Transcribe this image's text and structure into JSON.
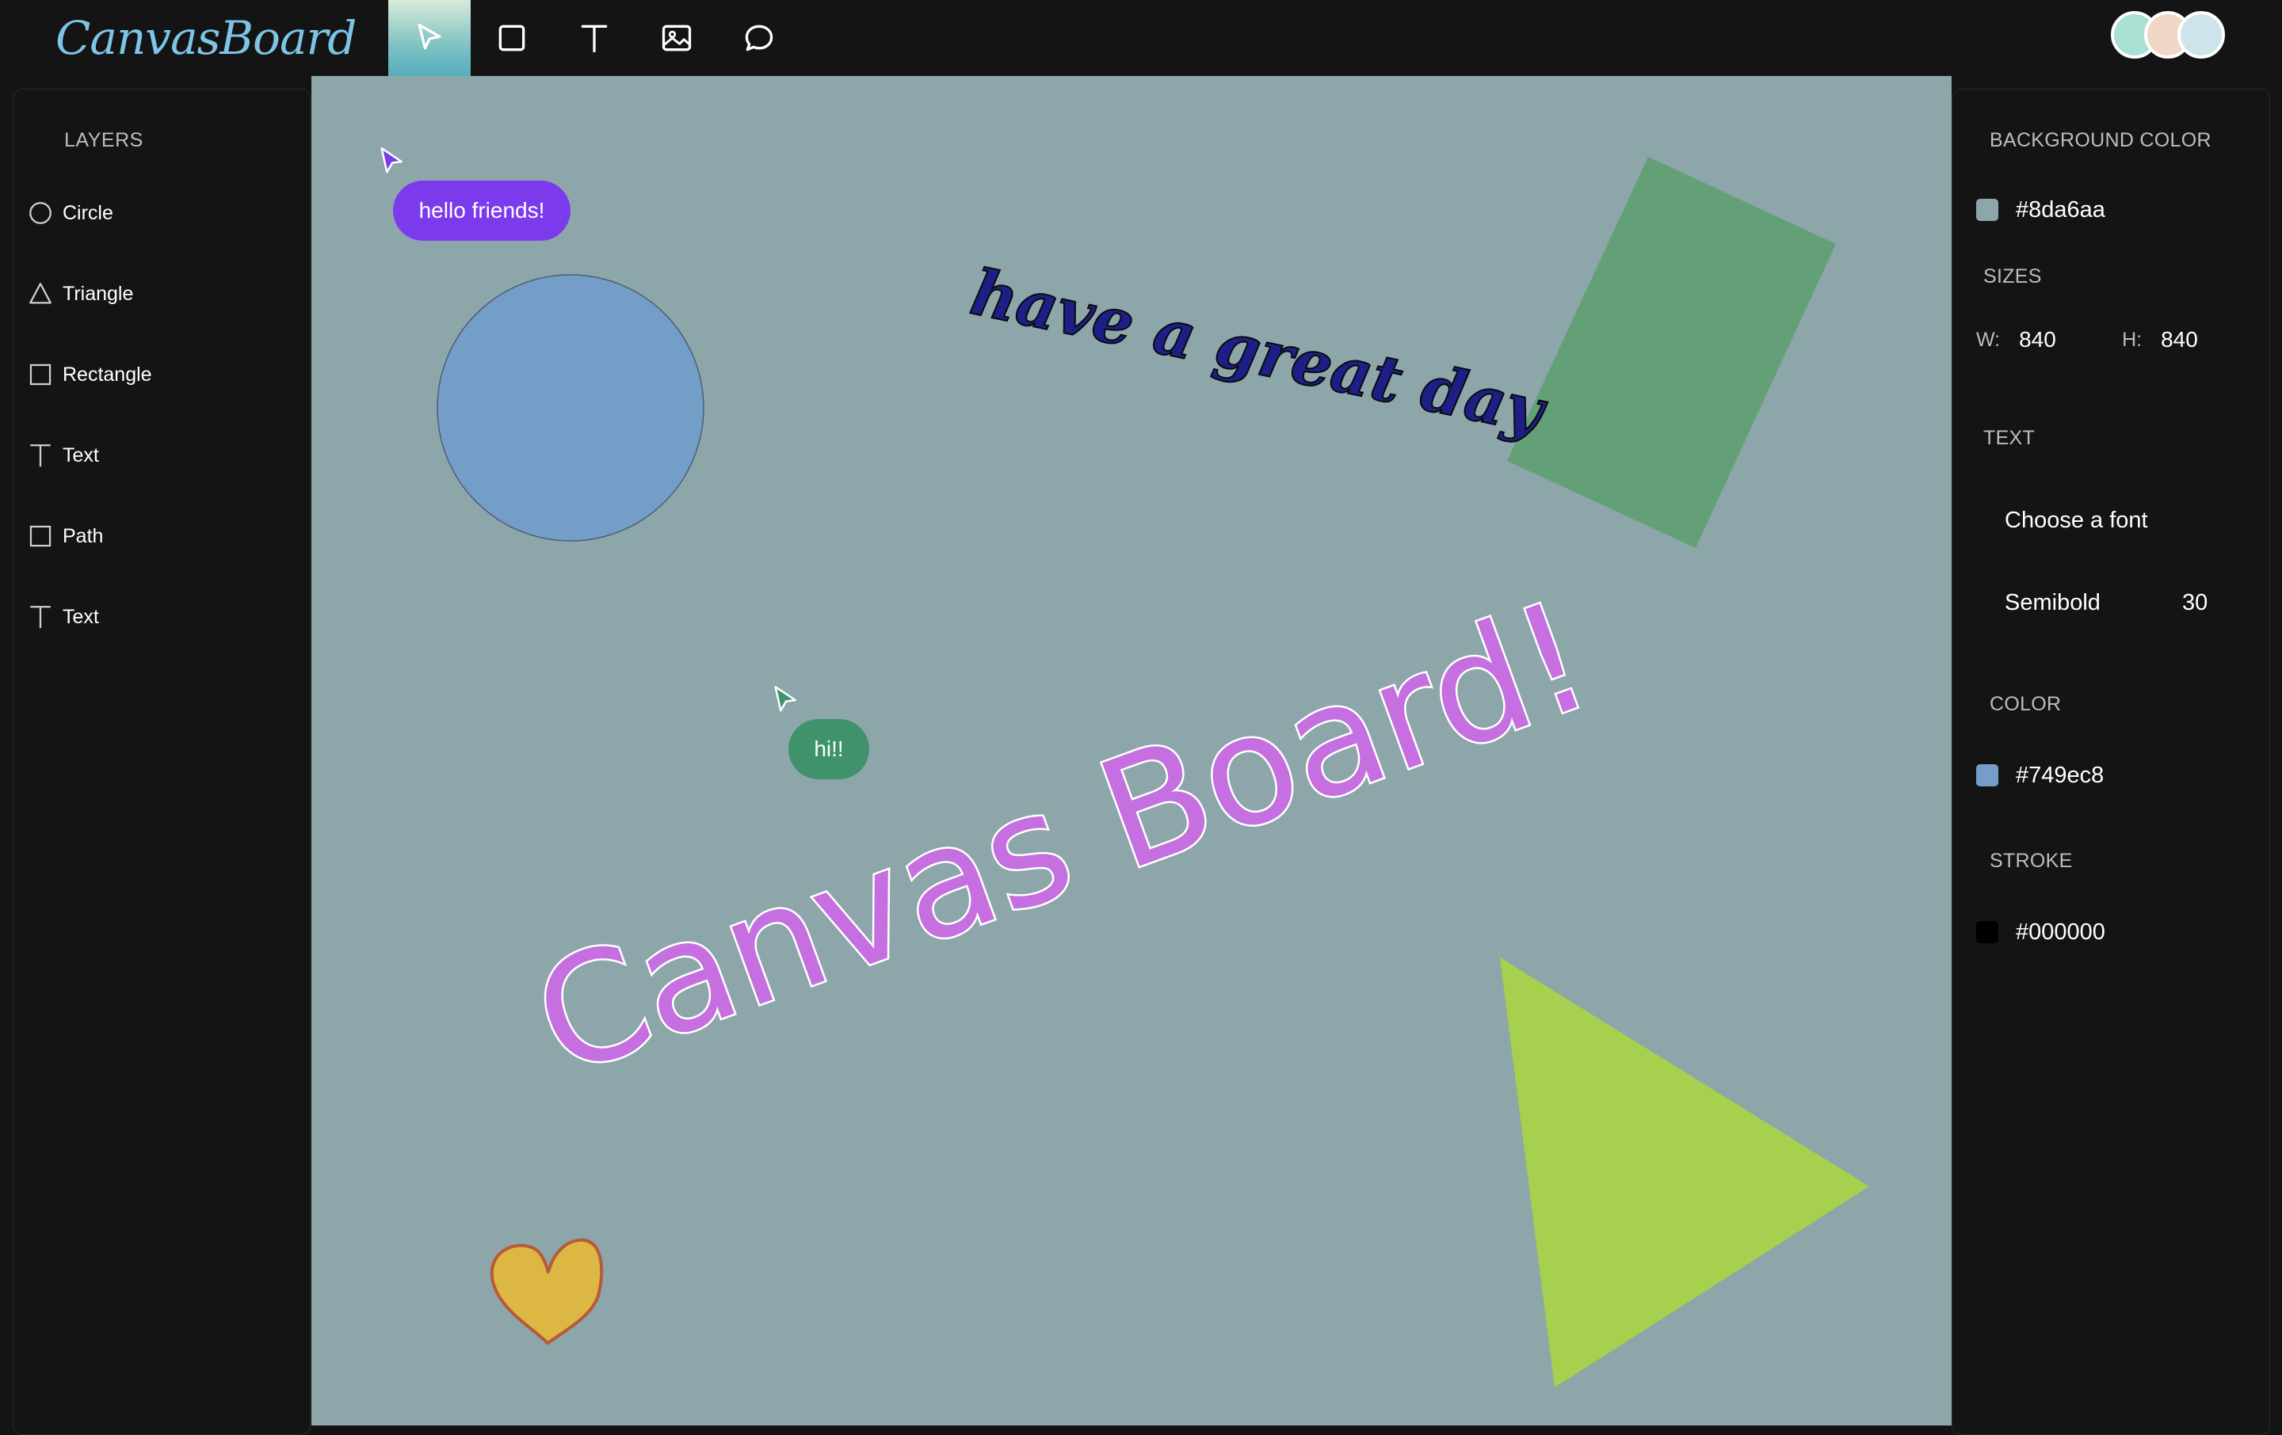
{
  "app": {
    "logo_text": "CanvasBoard"
  },
  "toolbar": {
    "tools": [
      {
        "name": "select",
        "icon": "cursor-arrow-icon",
        "active": true
      },
      {
        "name": "rectangle",
        "icon": "square-icon"
      },
      {
        "name": "text",
        "icon": "text-t-icon"
      },
      {
        "name": "image",
        "icon": "image-icon"
      },
      {
        "name": "comment",
        "icon": "speech-bubble-icon"
      }
    ]
  },
  "collaborators": [
    {
      "color": "#a8e0d4"
    },
    {
      "color": "#f0d7c6"
    },
    {
      "color": "#cfe3ec"
    }
  ],
  "layers": {
    "title": "LAYERS",
    "items": [
      {
        "label": "Circle",
        "icon": "circle-icon"
      },
      {
        "label": "Triangle",
        "icon": "triangle-icon"
      },
      {
        "label": "Rectangle",
        "icon": "square-icon"
      },
      {
        "label": "Text",
        "icon": "text-t-icon"
      },
      {
        "label": "Path",
        "icon": "square-icon"
      },
      {
        "label": "Text",
        "icon": "text-t-icon"
      }
    ]
  },
  "canvas": {
    "background": "#8da6aa",
    "comments": [
      {
        "text": "hello friends!",
        "color": "#7c3aed"
      },
      {
        "text": "hi!!",
        "color": "#3f926b"
      }
    ],
    "title_text": "Canvas Board!",
    "title_color": "#c66fe0",
    "script_text": "have a great day",
    "script_color": "#1d1f86",
    "circle_fill": "#749ec8",
    "rectangle_fill": "#64a077",
    "triangle_fill": "#a6d04d",
    "heart_fill": "#dcb744",
    "heart_stroke": "#b85a3a"
  },
  "properties": {
    "background": {
      "title": "BACKGROUND COLOR",
      "value": "#8da6aa"
    },
    "sizes": {
      "title": "SIZES",
      "w_label": "W:",
      "w_value": "840",
      "h_label": "H:",
      "h_value": "840"
    },
    "text": {
      "title": "TEXT",
      "font_placeholder": "Choose a font",
      "weight": "Semibold",
      "size": "30"
    },
    "color": {
      "title": "COLOR",
      "value": "#749ec8"
    },
    "stroke": {
      "title": "STROKE",
      "value": "#000000"
    }
  }
}
